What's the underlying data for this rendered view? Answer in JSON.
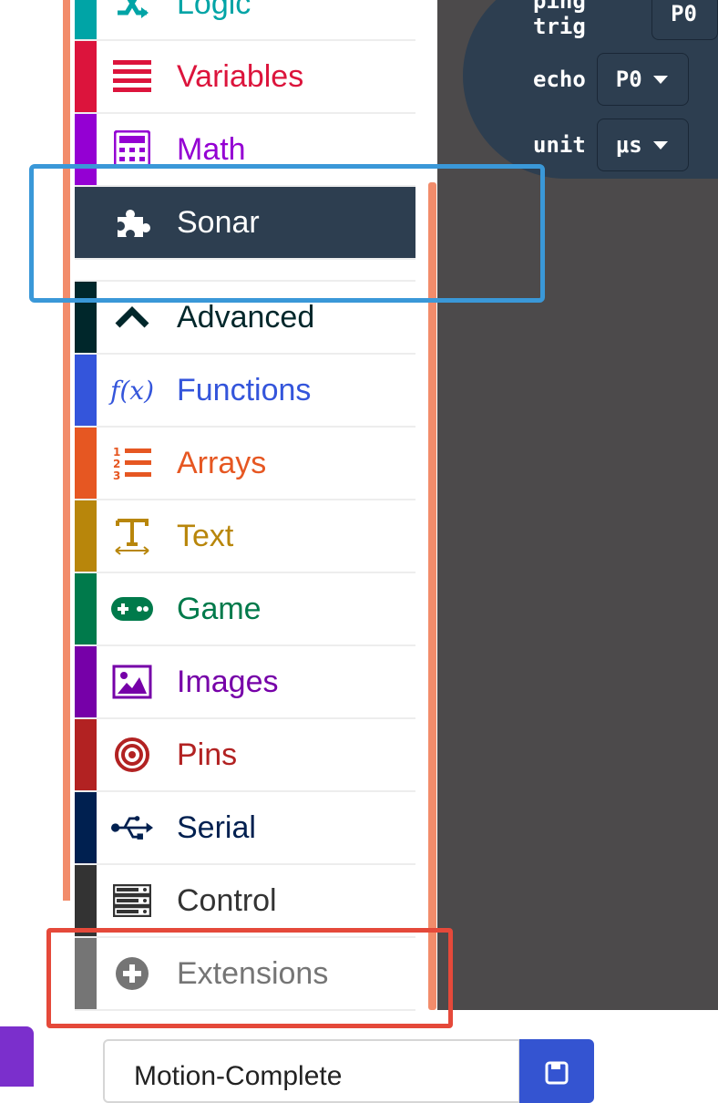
{
  "workspace": {
    "block": {
      "row1_label": "ping trig",
      "row1_value": "P0",
      "row2_label": "echo",
      "row2_value": "P0",
      "row3_label": "unit",
      "row3_value": "μs"
    }
  },
  "toolbox": {
    "categories": [
      {
        "label": "Logic",
        "color": "#00a4a6",
        "icon": "logic-icon"
      },
      {
        "label": "Variables",
        "color": "#dc143c",
        "icon": "variables-icon"
      },
      {
        "label": "Math",
        "color": "#9400d3",
        "icon": "math-icon"
      },
      {
        "label": "Sonar",
        "color": "#2d3e50",
        "icon": "puzzle-icon",
        "selected": true
      },
      {
        "label": "",
        "color": "#ffffff",
        "icon": ""
      },
      {
        "label": "Advanced",
        "color": "#00272b",
        "icon": "chevron-up-icon"
      },
      {
        "label": "Functions",
        "color": "#3455db",
        "icon": "function-icon"
      },
      {
        "label": "Arrays",
        "color": "#e65722",
        "icon": "list-icon"
      },
      {
        "label": "Text",
        "color": "#b8860b",
        "icon": "text-icon"
      },
      {
        "label": "Game",
        "color": "#007a4b",
        "icon": "gamepad-icon"
      },
      {
        "label": "Images",
        "color": "#7600a8",
        "icon": "image-icon"
      },
      {
        "label": "Pins",
        "color": "#b22222",
        "icon": "target-icon"
      },
      {
        "label": "Serial",
        "color": "#002050",
        "icon": "usb-icon"
      },
      {
        "label": "Control",
        "color": "#333333",
        "icon": "server-icon"
      },
      {
        "label": "Extensions",
        "color": "#757575",
        "icon": "plus-circle-icon"
      }
    ]
  },
  "footer": {
    "project_name": "Motion-Complete"
  }
}
